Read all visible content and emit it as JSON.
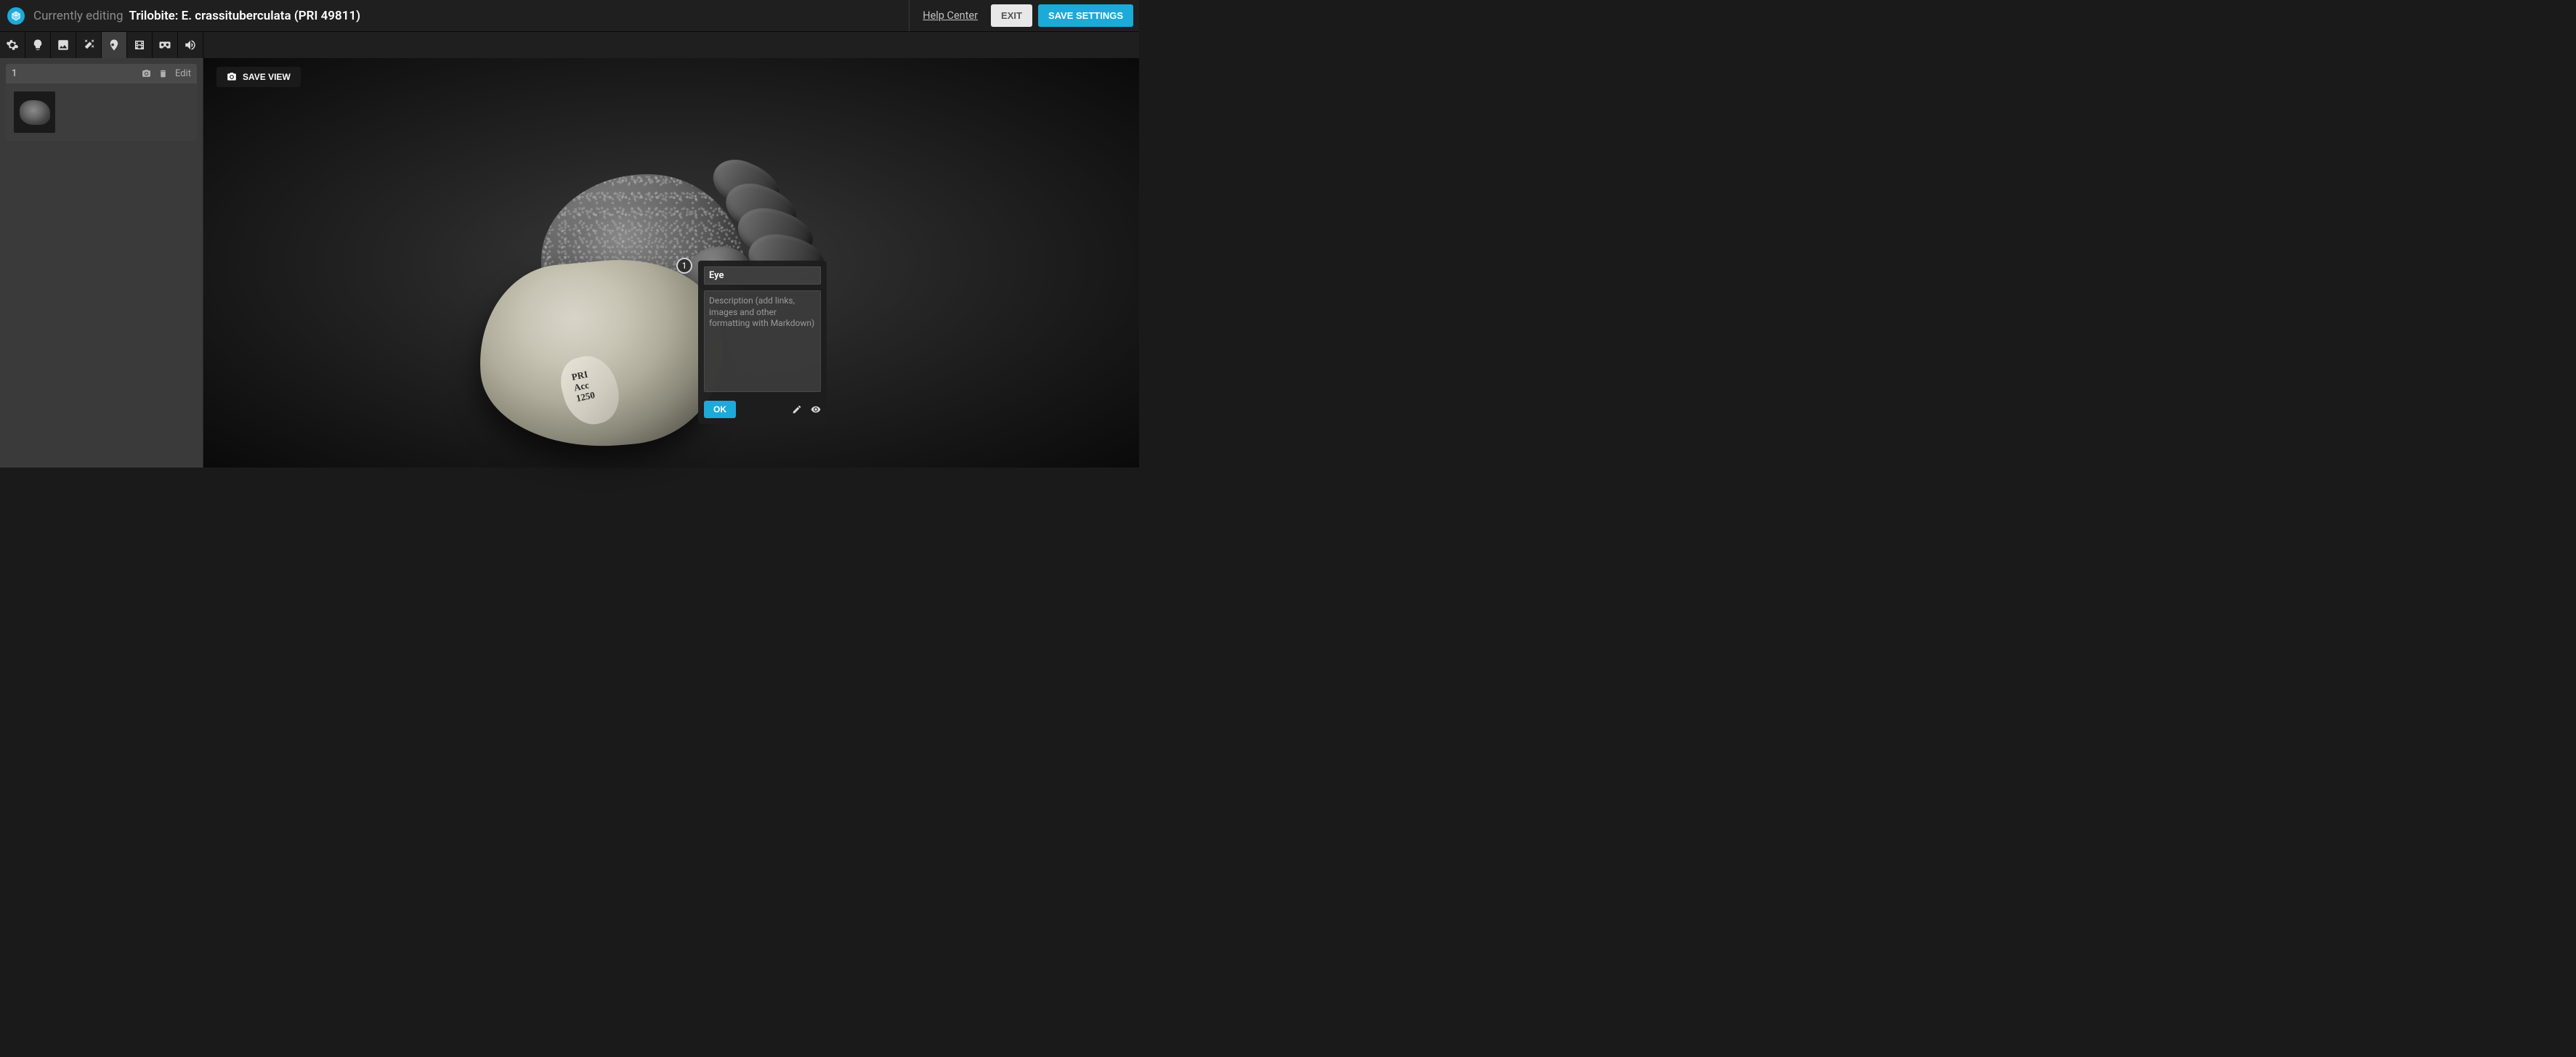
{
  "header": {
    "editing_label": "Currently editing",
    "title": "Trilobite: E. crassituberculata (PRI 49811)",
    "help_center": "Help Center",
    "exit": "EXIT",
    "save_settings": "SAVE SETTINGS"
  },
  "toolbar": {
    "tools": [
      {
        "name": "settings",
        "icon": "gear"
      },
      {
        "name": "lighting",
        "icon": "bulb"
      },
      {
        "name": "background",
        "icon": "image"
      },
      {
        "name": "materials",
        "icon": "wand"
      },
      {
        "name": "annotations",
        "icon": "pin",
        "active": true
      },
      {
        "name": "animation",
        "icon": "film"
      },
      {
        "name": "vr",
        "icon": "vr"
      },
      {
        "name": "sound",
        "icon": "sound"
      }
    ]
  },
  "sidebar": {
    "annotations": [
      {
        "number": "1",
        "edit_label": "Edit"
      }
    ]
  },
  "viewport": {
    "save_view": "SAVE VIEW",
    "marker_number": "1",
    "specimen_label": "PRI\nAcc\n1250"
  },
  "popup": {
    "title_value": "Eye",
    "desc_placeholder": "Description (add links, images and other formatting with Markdown)",
    "ok": "OK"
  },
  "colors": {
    "accent": "#1caad9"
  }
}
